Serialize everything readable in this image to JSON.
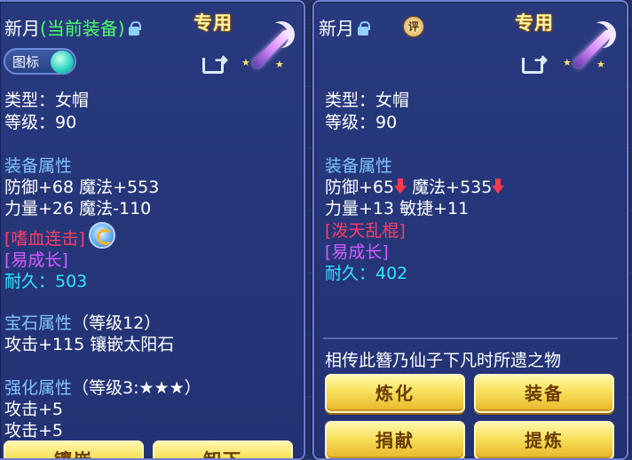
{
  "left": {
    "name": "新月",
    "current_tag": "(当前装备)",
    "special": "专用",
    "toggle_label": "图标",
    "type": "类型：女帽",
    "level": "等级：90",
    "equip_attr_header": "装备属性",
    "attr_line1": "防御+68 魔法+553",
    "attr_line2": "力量+26 魔法-110",
    "skill": "[嗜血连击]",
    "trait": "[易成长]",
    "durability": "耐久：503",
    "gem_header": "宝石属性",
    "gem_level": "（等级12）",
    "gem_line": "攻击+115 镶嵌太阳石",
    "enhance_header": "强化属性",
    "enhance_level": "（等级3:★★★）",
    "enhance_line1": "攻击+5",
    "enhance_line2": "攻击+5",
    "btn_inlay": "镶嵌",
    "btn_unequip": "卸下"
  },
  "right": {
    "name": "新月",
    "ping": "评",
    "special": "专用",
    "type": "类型：女帽",
    "level": "等级：90",
    "equip_attr_header": "装备属性",
    "attr1": "防御+65",
    "attr2": "魔法+535",
    "attr_line2": "力量+13 敏捷+11",
    "skill": "[泼天乱棍]",
    "trait": "[易成长]",
    "durability": "耐久：402",
    "lore": "相传此簪乃仙子下凡时所遗之物",
    "buttons": [
      "炼化",
      "装备",
      "捐献",
      "提炼"
    ]
  },
  "icons": {
    "lock": "lock-icon",
    "share": "share-icon",
    "weapon": "weapon-icon",
    "down": "arrow-down-icon",
    "gem": "gem-badge-icon"
  }
}
